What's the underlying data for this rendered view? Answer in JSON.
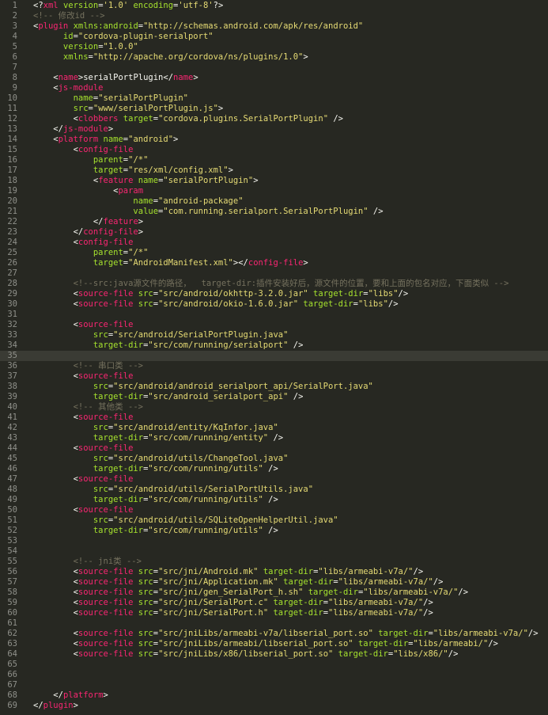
{
  "colors": {
    "background": "#272822",
    "current_line": "#3a3b34",
    "line_number": "#8f908a",
    "tag": "#f92672",
    "attribute": "#a6e22e",
    "string": "#e6db74",
    "comment": "#75715e",
    "text": "#f8f8f2"
  },
  "editor": {
    "current_line": 35,
    "lines": [
      [
        [
          "p",
          "<?"
        ],
        [
          "t",
          "xml"
        ],
        [
          "a",
          " version"
        ],
        [
          "p",
          "="
        ],
        [
          "s",
          "'1.0'"
        ],
        [
          "a",
          " encoding"
        ],
        [
          "p",
          "="
        ],
        [
          "s",
          "'utf-8'"
        ],
        [
          "p",
          "?>"
        ]
      ],
      [
        [
          "c",
          "<!-- 修改id -->"
        ]
      ],
      [
        [
          "p",
          "<"
        ],
        [
          "t",
          "plugin"
        ],
        [
          "a",
          " xmlns:android"
        ],
        [
          "p",
          "="
        ],
        [
          "s",
          "\"http://schemas.android.com/apk/res/android\""
        ]
      ],
      [
        [
          "a",
          "      id"
        ],
        [
          "p",
          "="
        ],
        [
          "s",
          "\"cordova-plugin-serialport\""
        ]
      ],
      [
        [
          "a",
          "      version"
        ],
        [
          "p",
          "="
        ],
        [
          "s",
          "\"1.0.0\""
        ]
      ],
      [
        [
          "a",
          "      xmlns"
        ],
        [
          "p",
          "="
        ],
        [
          "s",
          "\"http://apache.org/cordova/ns/plugins/1.0\""
        ],
        [
          "p",
          ">"
        ]
      ],
      [],
      [
        [
          "p",
          "    <"
        ],
        [
          "t",
          "name"
        ],
        [
          "p",
          ">"
        ],
        [
          "x",
          "serialPortPlugin"
        ],
        [
          "p",
          "</"
        ],
        [
          "t",
          "name"
        ],
        [
          "p",
          ">"
        ]
      ],
      [
        [
          "p",
          "    <"
        ],
        [
          "t",
          "js-module"
        ]
      ],
      [
        [
          "a",
          "        name"
        ],
        [
          "p",
          "="
        ],
        [
          "s",
          "\"serialPortPlugin\""
        ]
      ],
      [
        [
          "a",
          "        src"
        ],
        [
          "p",
          "="
        ],
        [
          "s",
          "\"www/serialPortPlugin.js\""
        ],
        [
          "p",
          ">"
        ]
      ],
      [
        [
          "p",
          "        <"
        ],
        [
          "t",
          "clobbers"
        ],
        [
          "a",
          " target"
        ],
        [
          "p",
          "="
        ],
        [
          "s",
          "\"cordova.plugins.SerialPortPlugin\""
        ],
        [
          "p",
          " />"
        ]
      ],
      [
        [
          "p",
          "    </"
        ],
        [
          "t",
          "js-module"
        ],
        [
          "p",
          ">"
        ]
      ],
      [
        [
          "p",
          "    <"
        ],
        [
          "t",
          "platform"
        ],
        [
          "a",
          " name"
        ],
        [
          "p",
          "="
        ],
        [
          "s",
          "\"android\""
        ],
        [
          "p",
          ">"
        ]
      ],
      [
        [
          "p",
          "        <"
        ],
        [
          "t",
          "config-file"
        ]
      ],
      [
        [
          "a",
          "            parent"
        ],
        [
          "p",
          "="
        ],
        [
          "s",
          "\"/*\""
        ]
      ],
      [
        [
          "a",
          "            target"
        ],
        [
          "p",
          "="
        ],
        [
          "s",
          "\"res/xml/config.xml\""
        ],
        [
          "p",
          ">"
        ]
      ],
      [
        [
          "p",
          "            <"
        ],
        [
          "t",
          "feature"
        ],
        [
          "a",
          " name"
        ],
        [
          "p",
          "="
        ],
        [
          "s",
          "\"serialPortPlugin\""
        ],
        [
          "p",
          ">"
        ]
      ],
      [
        [
          "p",
          "                <"
        ],
        [
          "t",
          "param"
        ]
      ],
      [
        [
          "a",
          "                    name"
        ],
        [
          "p",
          "="
        ],
        [
          "s",
          "\"android-package\""
        ]
      ],
      [
        [
          "a",
          "                    value"
        ],
        [
          "p",
          "="
        ],
        [
          "s",
          "\"com.running.serialport.SerialPortPlugin\""
        ],
        [
          "p",
          " />"
        ]
      ],
      [
        [
          "p",
          "            </"
        ],
        [
          "t",
          "feature"
        ],
        [
          "p",
          ">"
        ]
      ],
      [
        [
          "p",
          "        </"
        ],
        [
          "t",
          "config-file"
        ],
        [
          "p",
          ">"
        ]
      ],
      [
        [
          "p",
          "        <"
        ],
        [
          "t",
          "config-file"
        ]
      ],
      [
        [
          "a",
          "            parent"
        ],
        [
          "p",
          "="
        ],
        [
          "s",
          "\"/*\""
        ]
      ],
      [
        [
          "a",
          "            target"
        ],
        [
          "p",
          "="
        ],
        [
          "s",
          "\"AndroidManifest.xml\""
        ],
        [
          "p",
          ">"
        ],
        [
          "p",
          "</"
        ],
        [
          "t",
          "config-file"
        ],
        [
          "p",
          ">"
        ]
      ],
      [],
      [
        [
          "c",
          "        <!--src:java源文件的路径，  target-dir:插件安装好后，源文件的位置，要和上面的包名对应，下面类似 -->"
        ]
      ],
      [
        [
          "p",
          "        <"
        ],
        [
          "t",
          "source-file"
        ],
        [
          "a",
          " src"
        ],
        [
          "p",
          "="
        ],
        [
          "s",
          "\"src/android/okhttp-3.2.0.jar\""
        ],
        [
          "a",
          " target-dir"
        ],
        [
          "p",
          "="
        ],
        [
          "s",
          "\"libs\""
        ],
        [
          "p",
          "/>"
        ]
      ],
      [
        [
          "p",
          "        <"
        ],
        [
          "t",
          "source-file"
        ],
        [
          "a",
          " src"
        ],
        [
          "p",
          "="
        ],
        [
          "s",
          "\"src/android/okio-1.6.0.jar\""
        ],
        [
          "a",
          " target-dir"
        ],
        [
          "p",
          "="
        ],
        [
          "s",
          "\"libs\""
        ],
        [
          "p",
          "/>"
        ]
      ],
      [],
      [
        [
          "p",
          "        <"
        ],
        [
          "t",
          "source-file"
        ]
      ],
      [
        [
          "a",
          "            src"
        ],
        [
          "p",
          "="
        ],
        [
          "s",
          "\"src/android/SerialPortPlugin.java\""
        ]
      ],
      [
        [
          "a",
          "            target-dir"
        ],
        [
          "p",
          "="
        ],
        [
          "s",
          "\"src/com/running/serialport\""
        ],
        [
          "p",
          " />"
        ]
      ],
      [],
      [
        [
          "c",
          "        <!-- 串口类 -->"
        ]
      ],
      [
        [
          "p",
          "        <"
        ],
        [
          "t",
          "source-file"
        ]
      ],
      [
        [
          "a",
          "            src"
        ],
        [
          "p",
          "="
        ],
        [
          "s",
          "\"src/android/android_serialport_api/SerialPort.java\""
        ]
      ],
      [
        [
          "a",
          "            target-dir"
        ],
        [
          "p",
          "="
        ],
        [
          "s",
          "\"src/android_serialport_api\""
        ],
        [
          "p",
          " />"
        ]
      ],
      [
        [
          "c",
          "        <!-- 其他类 -->"
        ]
      ],
      [
        [
          "p",
          "        <"
        ],
        [
          "t",
          "source-file"
        ]
      ],
      [
        [
          "a",
          "            src"
        ],
        [
          "p",
          "="
        ],
        [
          "s",
          "\"src/android/entity/KqInfor.java\""
        ]
      ],
      [
        [
          "a",
          "            target-dir"
        ],
        [
          "p",
          "="
        ],
        [
          "s",
          "\"src/com/running/entity\""
        ],
        [
          "p",
          " />"
        ]
      ],
      [
        [
          "p",
          "        <"
        ],
        [
          "t",
          "source-file"
        ]
      ],
      [
        [
          "a",
          "            src"
        ],
        [
          "p",
          "="
        ],
        [
          "s",
          "\"src/android/utils/ChangeTool.java\""
        ]
      ],
      [
        [
          "a",
          "            target-dir"
        ],
        [
          "p",
          "="
        ],
        [
          "s",
          "\"src/com/running/utils\""
        ],
        [
          "p",
          " />"
        ]
      ],
      [
        [
          "p",
          "        <"
        ],
        [
          "t",
          "source-file"
        ]
      ],
      [
        [
          "a",
          "            src"
        ],
        [
          "p",
          "="
        ],
        [
          "s",
          "\"src/android/utils/SerialPortUtils.java\""
        ]
      ],
      [
        [
          "a",
          "            target-dir"
        ],
        [
          "p",
          "="
        ],
        [
          "s",
          "\"src/com/running/utils\""
        ],
        [
          "p",
          " />"
        ]
      ],
      [
        [
          "p",
          "        <"
        ],
        [
          "t",
          "source-file"
        ]
      ],
      [
        [
          "a",
          "            src"
        ],
        [
          "p",
          "="
        ],
        [
          "s",
          "\"src/android/utils/SQLiteOpenHelperUtil.java\""
        ]
      ],
      [
        [
          "a",
          "            target-dir"
        ],
        [
          "p",
          "="
        ],
        [
          "s",
          "\"src/com/running/utils\""
        ],
        [
          "p",
          " />"
        ]
      ],
      [],
      [],
      [
        [
          "c",
          "        <!-- jni类 -->"
        ]
      ],
      [
        [
          "p",
          "        <"
        ],
        [
          "t",
          "source-file"
        ],
        [
          "a",
          " src"
        ],
        [
          "p",
          "="
        ],
        [
          "s",
          "\"src/jni/Android.mk\""
        ],
        [
          "a",
          " target-dir"
        ],
        [
          "p",
          "="
        ],
        [
          "s",
          "\"libs/armeabi-v7a/\""
        ],
        [
          "p",
          "/>"
        ]
      ],
      [
        [
          "p",
          "        <"
        ],
        [
          "t",
          "source-file"
        ],
        [
          "a",
          " src"
        ],
        [
          "p",
          "="
        ],
        [
          "s",
          "\"src/jni/Application.mk\""
        ],
        [
          "a",
          " target-dir"
        ],
        [
          "p",
          "="
        ],
        [
          "s",
          "\"libs/armeabi-v7a/\""
        ],
        [
          "p",
          "/>"
        ]
      ],
      [
        [
          "p",
          "        <"
        ],
        [
          "t",
          "source-file"
        ],
        [
          "a",
          " src"
        ],
        [
          "p",
          "="
        ],
        [
          "s",
          "\"src/jni/gen_SerialPort_h.sh\""
        ],
        [
          "a",
          " target-dir"
        ],
        [
          "p",
          "="
        ],
        [
          "s",
          "\"libs/armeabi-v7a/\""
        ],
        [
          "p",
          "/>"
        ]
      ],
      [
        [
          "p",
          "        <"
        ],
        [
          "t",
          "source-file"
        ],
        [
          "a",
          " src"
        ],
        [
          "p",
          "="
        ],
        [
          "s",
          "\"src/jni/SerialPort.c\""
        ],
        [
          "a",
          " target-dir"
        ],
        [
          "p",
          "="
        ],
        [
          "s",
          "\"libs/armeabi-v7a/\""
        ],
        [
          "p",
          "/>"
        ]
      ],
      [
        [
          "p",
          "        <"
        ],
        [
          "t",
          "source-file"
        ],
        [
          "a",
          " src"
        ],
        [
          "p",
          "="
        ],
        [
          "s",
          "\"src/jni/SerialPort.h\""
        ],
        [
          "a",
          " target-dir"
        ],
        [
          "p",
          "="
        ],
        [
          "s",
          "\"libs/armeabi-v7a/\""
        ],
        [
          "p",
          "/>"
        ]
      ],
      [],
      [
        [
          "p",
          "        <"
        ],
        [
          "t",
          "source-file"
        ],
        [
          "a",
          " src"
        ],
        [
          "p",
          "="
        ],
        [
          "s",
          "\"src/jniLibs/armeabi-v7a/libserial_port.so\""
        ],
        [
          "a",
          " target-dir"
        ],
        [
          "p",
          "="
        ],
        [
          "s",
          "\"libs/armeabi-v7a/\""
        ],
        [
          "p",
          "/>"
        ]
      ],
      [
        [
          "p",
          "        <"
        ],
        [
          "t",
          "source-file"
        ],
        [
          "a",
          " src"
        ],
        [
          "p",
          "="
        ],
        [
          "s",
          "\"src/jniLibs/armeabi/libserial_port.so\""
        ],
        [
          "a",
          " target-dir"
        ],
        [
          "p",
          "="
        ],
        [
          "s",
          "\"libs/armeabi/\""
        ],
        [
          "p",
          "/>"
        ]
      ],
      [
        [
          "p",
          "        <"
        ],
        [
          "t",
          "source-file"
        ],
        [
          "a",
          " src"
        ],
        [
          "p",
          "="
        ],
        [
          "s",
          "\"src/jniLibs/x86/libserial_port.so\""
        ],
        [
          "a",
          " target-dir"
        ],
        [
          "p",
          "="
        ],
        [
          "s",
          "\"libs/x86/\""
        ],
        [
          "p",
          "/>"
        ]
      ],
      [],
      [],
      [],
      [
        [
          "p",
          "    </"
        ],
        [
          "t",
          "platform"
        ],
        [
          "p",
          ">"
        ]
      ],
      [
        [
          "p",
          "</"
        ],
        [
          "t",
          "plugin"
        ],
        [
          "p",
          ">"
        ]
      ]
    ]
  }
}
